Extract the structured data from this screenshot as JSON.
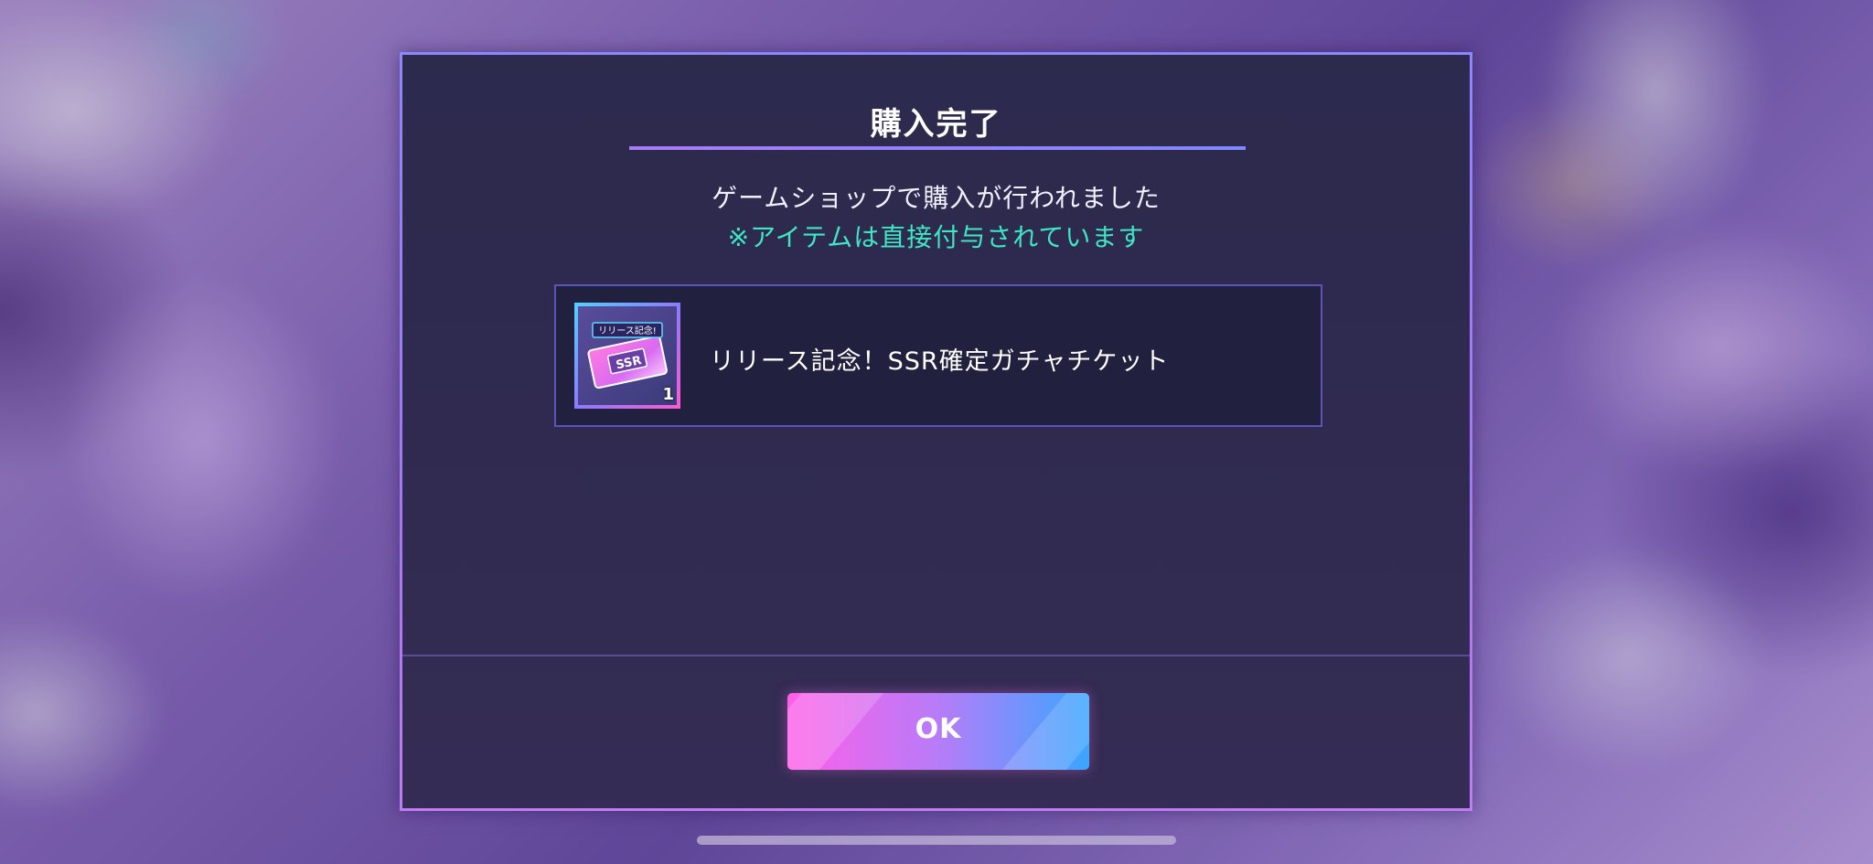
{
  "dialog": {
    "title": "購入完了",
    "message": "ゲームショップで購入が行われました",
    "notice": "※アイテムは直接付与されています",
    "item": {
      "name": "リリース記念！SSR確定ガチャチケット",
      "count": "1",
      "icon": "ssr-ticket-icon",
      "icon_banner": "リリース記念!",
      "icon_ticket_label": "SSR"
    },
    "ok_label": "OK"
  },
  "colors": {
    "notice": "#3fe6c4",
    "dialog_border": "#8c86ff",
    "button_left": "#ff5fe8",
    "button_right": "#3aa6ff"
  }
}
